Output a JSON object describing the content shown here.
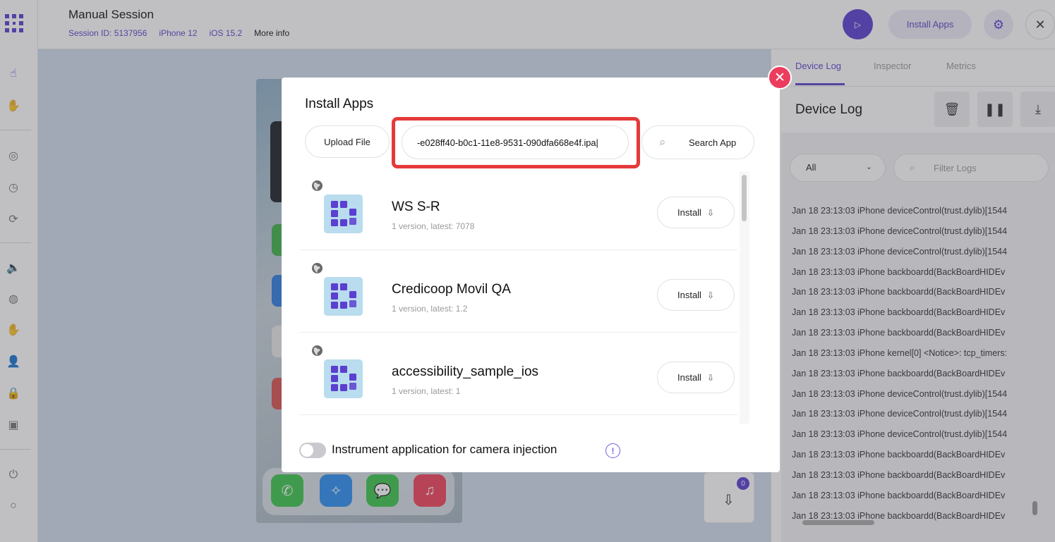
{
  "session": {
    "title": "Manual Session",
    "session_id": "Session ID: 5137956",
    "device": "iPhone 12",
    "os": "iOS 15.2",
    "more_info": "More info"
  },
  "topbar": {
    "install_apps_label": "Install Apps"
  },
  "device_log": {
    "tabs": [
      "Device Log",
      "Inspector",
      "Metrics"
    ],
    "title": "Device Log",
    "level_filter": "All",
    "filter_placeholder": "Filter Logs",
    "lines": [
      "Jan 18 23:13:03 iPhone deviceControl(trust.dylib)[1544",
      "Jan 18 23:13:03 iPhone deviceControl(trust.dylib)[1544",
      "Jan 18 23:13:03 iPhone deviceControl(trust.dylib)[1544",
      "Jan 18 23:13:03 iPhone backboardd(BackBoardHIDEv",
      "Jan 18 23:13:03 iPhone backboardd(BackBoardHIDEv",
      "Jan 18 23:13:03 iPhone backboardd(BackBoardHIDEv",
      "Jan 18 23:13:03 iPhone backboardd(BackBoardHIDEv",
      "Jan 18 23:13:03 iPhone kernel[0] <Notice>: tcp_timers:",
      "Jan 18 23:13:03 iPhone backboardd(BackBoardHIDEv",
      "Jan 18 23:13:03 iPhone deviceControl(trust.dylib)[1544",
      "Jan 18 23:13:03 iPhone deviceControl(trust.dylib)[1544",
      "Jan 18 23:13:03 iPhone deviceControl(trust.dylib)[1544",
      "Jan 18 23:13:03 iPhone backboardd(BackBoardHIDEv",
      "Jan 18 23:13:03 iPhone backboardd(BackBoardHIDEv",
      "Jan 18 23:13:03 iPhone backboardd(BackBoardHIDEv",
      "Jan 18 23:13:03 iPhone backboardd(BackBoardHIDEv"
    ]
  },
  "install_counter": "0",
  "modal": {
    "title": "Install Apps",
    "upload_label": "Upload File",
    "url_value": "-e028ff40-b0c1-11e8-9531-090dfa668e4f.ipa|",
    "search_label": "Search App",
    "install_label": "Install",
    "apps": [
      {
        "name": "WS S-R",
        "version": "1 version, latest: 7078"
      },
      {
        "name": "Credicoop Movil QA",
        "version": "1 version, latest: 1.2"
      },
      {
        "name": "accessibility_sample_ios",
        "version": "1 version, latest: 1"
      }
    ],
    "camera_toggle_label": "Instrument application for camera injection",
    "camera_toggle_on": false,
    "info_glyph": "!"
  },
  "colors": {
    "accent": "#5b3fd0",
    "close_red": "#ec3c5e",
    "highlight_red": "#e53a3a"
  }
}
